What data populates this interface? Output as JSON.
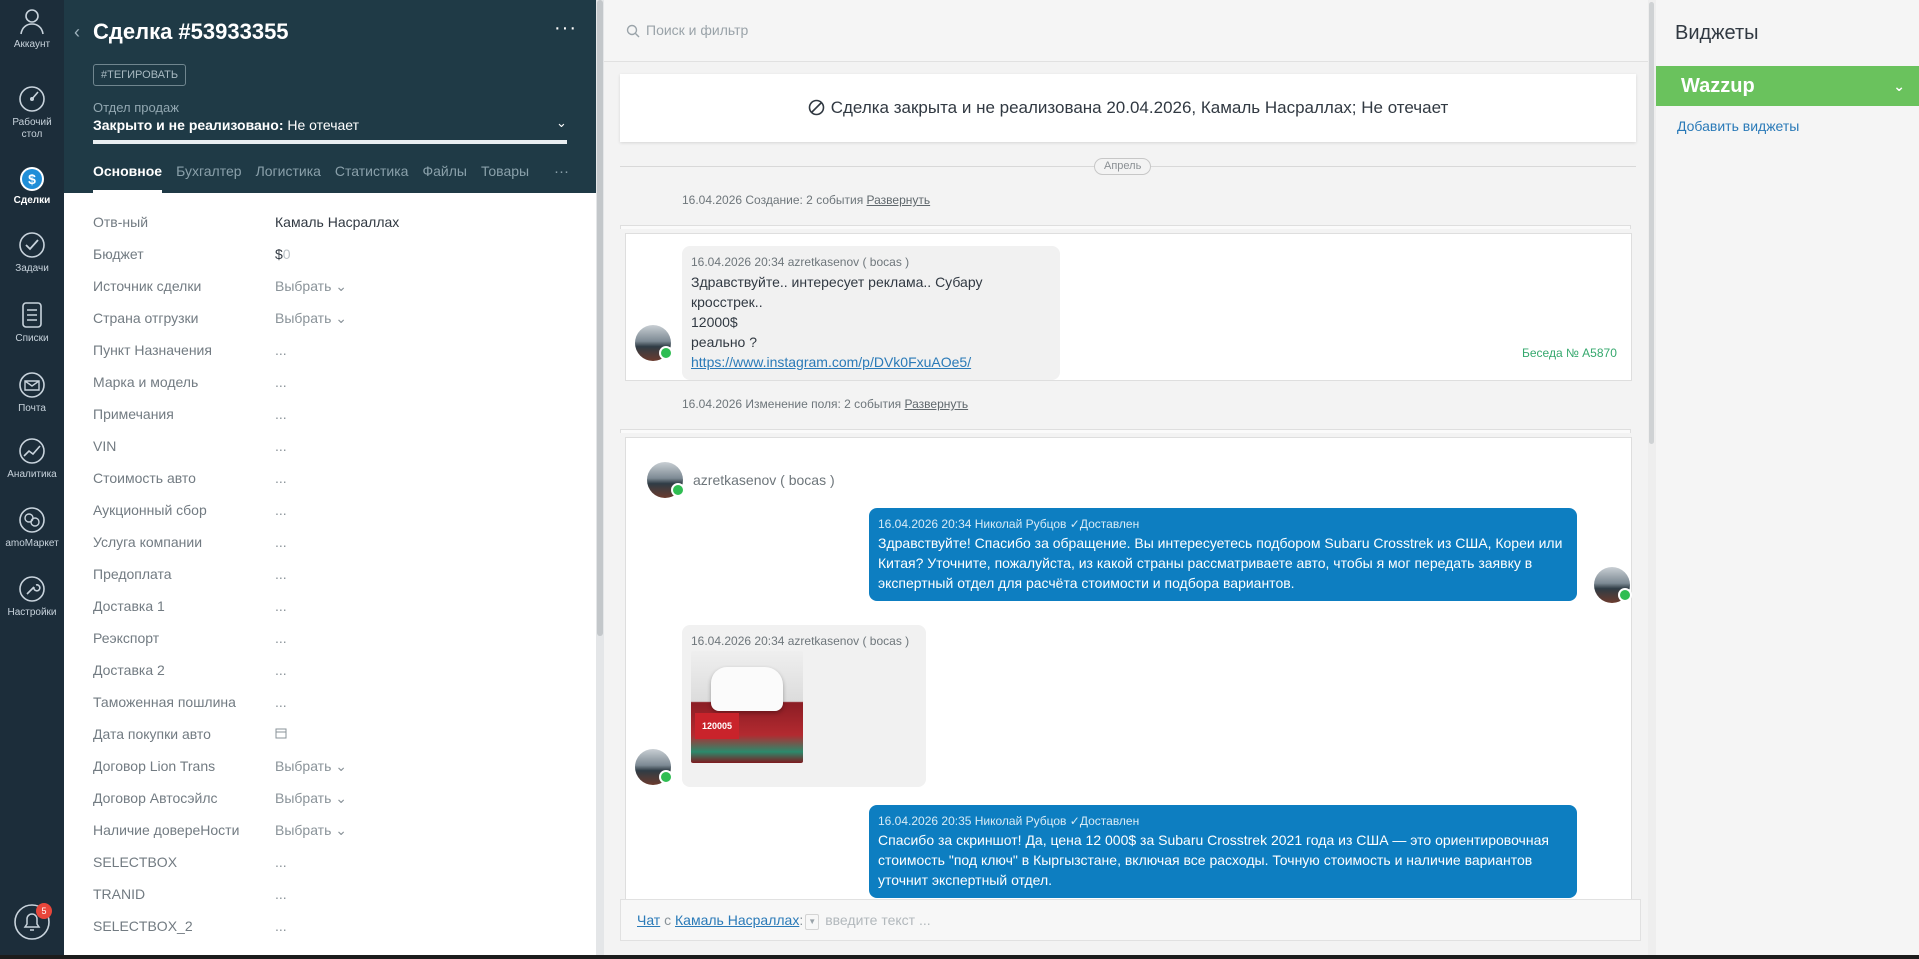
{
  "nav": {
    "items": [
      {
        "label": "Аккаунт",
        "icon": "account-icon"
      },
      {
        "label": "Рабочий стол",
        "icon": "dashboard-icon"
      },
      {
        "label": "Сделки",
        "icon": "deals-icon"
      },
      {
        "label": "Задачи",
        "icon": "tasks-icon"
      },
      {
        "label": "Списки",
        "icon": "lists-icon"
      },
      {
        "label": "Почта",
        "icon": "mail-icon"
      },
      {
        "label": "Аналитика",
        "icon": "analytics-icon"
      },
      {
        "label": "amoМаркет",
        "icon": "market-icon"
      },
      {
        "label": "Настройки",
        "icon": "settings-icon"
      }
    ],
    "notifications_count": "5"
  },
  "deal": {
    "title": "Сделка #53933355",
    "tag_button": "#ТЕГИРОВАТЬ",
    "pipeline": "Отдел продаж",
    "status_label": "Закрыто и не реализовано:",
    "status_reason": " Не отечает",
    "tabs": [
      "Основное",
      "Бухгалтер",
      "Логистика",
      "Статистика",
      "Файлы",
      "Товары"
    ],
    "more": "···",
    "fields": [
      {
        "label": "Отв-ный",
        "value": "Камаль Насраллах"
      },
      {
        "label": "Бюджет",
        "value": "$",
        "value_dim": "0"
      },
      {
        "label": "Источник сделки",
        "value": "Выбрать"
      },
      {
        "label": "Страна отгрузки",
        "value": "Выбрать"
      },
      {
        "label": "Пункт Назначения",
        "value": "..."
      },
      {
        "label": "Марка и модель",
        "value": "..."
      },
      {
        "label": "Примечания",
        "value": "..."
      },
      {
        "label": "VIN",
        "value": "..."
      },
      {
        "label": "Стоимость авто",
        "value": "..."
      },
      {
        "label": "Аукционный сбор",
        "value": "..."
      },
      {
        "label": "Услуга компании",
        "value": "..."
      },
      {
        "label": "Предоплата",
        "value": "..."
      },
      {
        "label": "Доставка 1",
        "value": "..."
      },
      {
        "label": "Реэкспорт",
        "value": "..."
      },
      {
        "label": "Доставка 2",
        "value": "..."
      },
      {
        "label": "Таможенная пошлина",
        "value": "..."
      },
      {
        "label": "Дата покупки авто",
        "value": ""
      },
      {
        "label": "Договор Lion Trans",
        "value": "Выбрать"
      },
      {
        "label": "Договор Автосэйлс",
        "value": "Выбрать"
      },
      {
        "label": "Наличие довереНости",
        "value": "Выбрать"
      },
      {
        "label": "SELECTBOX",
        "value": "..."
      },
      {
        "label": "TRANID",
        "value": "..."
      },
      {
        "label": "SELECTBOX_2",
        "value": "..."
      }
    ]
  },
  "feed": {
    "search_placeholder": "Поиск и фильтр",
    "closed_notice": "Сделка закрыта и не реализована 20.04.2026, Камаль Насраллах; Не отечает",
    "month": "Апрель",
    "summary1_text": "16.04.2026 Создание: 2 события ",
    "summary2_text": "16.04.2026 Изменение поля: 2 события ",
    "expand": "Развернуть",
    "msg1": {
      "meta": "16.04.2026 20:34 azretkasenov ( bocas )",
      "line1": "Здравствуйте.. интересует реклама.. Субару кросстрек..",
      "line2": "12000$",
      "line3": "реально ?",
      "link": "https://www.instagram.com/p/DVk0FxuAOe5/"
    },
    "conversation": "Беседа № A5870",
    "sender": "azretkasenov ( bocas )",
    "msg2": {
      "meta": "16.04.2026 20:34 Николай Рубцов",
      "status": "Доставлен",
      "text": "Здравствуйте! Спасибо за обращение. Вы интересуетесь подбором Subaru Crosstrek из США, Кореи или Китая? Уточните, пожалуйста, из какой страны рассматриваете авто, чтобы я мог передать заявку в экспертный отдел для расчёта стоимости и подбора вариантов."
    },
    "msg3": {
      "meta": "16.04.2026 20:34 azretkasenov ( bocas )",
      "image_caption": "120005"
    },
    "msg4": {
      "meta": "16.04.2026 20:35 Николай Рубцов",
      "status": "Доставлен",
      "text": "Спасибо за скриншот! Да, цена 12 000$ за Subaru Crosstrek 2021 года из США — это ориентировочная стоимость \"под ключ\" в Кыргызстане, включая все расходы. Точную стоимость и наличие вариантов уточнит экспертный отдел."
    },
    "chat": {
      "prefix": "Чат",
      "with": " с ",
      "contact": "Камаль Насраллах",
      "colon": ":",
      "placeholder": "введите текст ..."
    }
  },
  "widgets": {
    "title": "Виджеты",
    "wazzup": "Wazzup",
    "add": "Добавить виджеты"
  },
  "colors": {
    "nav_bg": "#1c2d3a",
    "deal_header": "#1f3a46",
    "outgoing": "#0d7ec1",
    "wazzup": "#6ac25d",
    "whatsapp": "#2fbd52"
  }
}
